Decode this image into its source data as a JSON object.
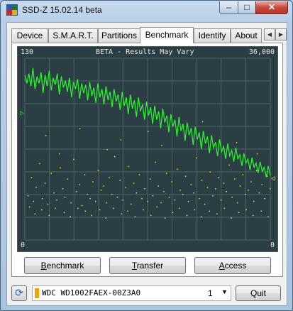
{
  "window": {
    "title": "SSD-Z 15.02.14 beta",
    "caption": {
      "minimize": "–",
      "maximize": "□",
      "close": "✕"
    }
  },
  "tabs": [
    {
      "label": "Device",
      "active": false
    },
    {
      "label": "S.M.A.R.T.",
      "active": false
    },
    {
      "label": "Partitions",
      "active": false
    },
    {
      "label": "Benchmark",
      "active": true
    },
    {
      "label": "Identify",
      "active": false
    },
    {
      "label": "About",
      "active": false
    }
  ],
  "tab_scroll": {
    "left": "◀",
    "right": "▶"
  },
  "graph": {
    "title": "BETA - Results May Vary",
    "left_max": "130",
    "right_max": "36,000",
    "left_min": "0",
    "right_min": "0",
    "left_marker": "▷",
    "right_marker": "◁",
    "colors": {
      "background": "#2b3e44",
      "grid": "#4f6167",
      "line": "#22ff22",
      "dots": "#e6e600"
    }
  },
  "buttons": {
    "benchmark": {
      "underline": "B",
      "rest": "enchmark"
    },
    "transfer": {
      "underline": "T",
      "rest": "ransfer"
    },
    "access": {
      "underline": "A",
      "rest": "ccess"
    }
  },
  "bottom": {
    "refresh_icon": "refresh-icon",
    "drive_name": "WDC WD1002FAEX-00Z3A0",
    "drive_index": "1",
    "drive_color": "#f6a000",
    "dropdown_icon": "▼",
    "quit_label": "Quit"
  },
  "chart_data": {
    "type": "line",
    "title": "BETA - Results May Vary",
    "ylim_left": [
      0,
      130
    ],
    "ylim_right": [
      0,
      36000
    ],
    "series": [
      {
        "values": [
          118,
          112,
          119,
          110,
          123,
          108,
          117,
          112,
          120,
          105,
          118,
          110,
          121,
          107,
          116,
          111,
          119,
          104,
          117,
          109,
          114,
          106,
          116,
          102,
          113,
          108,
          115,
          101,
          112,
          105,
          111,
          100,
          113,
          103,
          109,
          98,
          112,
          102,
          108,
          97,
          110,
          100,
          106,
          95,
          108,
          99,
          104,
          93,
          106,
          96,
          102,
          90,
          104,
          94,
          100,
          88,
          102,
          92,
          97,
          86,
          99,
          89,
          95,
          83,
          96,
          86,
          92,
          80,
          94,
          84,
          89,
          77,
          90,
          81,
          86,
          74,
          88,
          78,
          83,
          71,
          84,
          75,
          80,
          68,
          81,
          72,
          77,
          65,
          78,
          69,
          74,
          62,
          75,
          66,
          70,
          60,
          72,
          63,
          67,
          58,
          69,
          60,
          64,
          56,
          66,
          58,
          61,
          53,
          62,
          55,
          58,
          50,
          59,
          52,
          55,
          48,
          56,
          49,
          52,
          45,
          53,
          46
        ]
      }
    ],
    "scatter": {
      "points": [
        [
          4,
          32
        ],
        [
          9,
          45
        ],
        [
          12,
          28
        ],
        [
          16,
          38
        ],
        [
          21,
          55
        ],
        [
          25,
          30
        ],
        [
          29,
          41
        ],
        [
          33,
          26
        ],
        [
          38,
          48
        ],
        [
          42,
          34
        ],
        [
          46,
          29
        ],
        [
          51,
          52
        ],
        [
          55,
          37
        ],
        [
          58,
          31
        ],
        [
          62,
          44
        ],
        [
          67,
          27
        ],
        [
          71,
          58
        ],
        [
          75,
          35
        ],
        [
          79,
          40
        ],
        [
          83,
          25
        ],
        [
          87,
          47
        ],
        [
          91,
          33
        ],
        [
          95,
          30
        ],
        [
          99,
          42
        ],
        [
          103,
          28
        ],
        [
          107,
          50
        ],
        [
          111,
          36
        ],
        [
          115,
          39
        ],
        [
          119,
          27
        ],
        [
          123,
          45
        ],
        [
          127,
          33
        ],
        [
          131,
          60
        ],
        [
          135,
          31
        ],
        [
          139,
          43
        ],
        [
          143,
          29
        ],
        [
          147,
          38
        ],
        [
          151,
          53
        ],
        [
          155,
          26
        ],
        [
          159,
          41
        ],
        [
          163,
          34
        ],
        [
          167,
          47
        ],
        [
          171,
          30
        ],
        [
          175,
          37
        ],
        [
          179,
          28
        ],
        [
          183,
          44
        ],
        [
          187,
          32
        ],
        [
          191,
          56
        ],
        [
          195,
          39
        ],
        [
          199,
          27
        ],
        [
          203,
          35
        ],
        [
          207,
          48
        ],
        [
          211,
          31
        ],
        [
          215,
          42
        ],
        [
          219,
          29
        ],
        [
          223,
          51
        ],
        [
          227,
          36
        ],
        [
          231,
          33
        ],
        [
          235,
          46
        ],
        [
          239,
          28
        ],
        [
          243,
          40
        ],
        [
          247,
          34
        ],
        [
          251,
          59
        ],
        [
          255,
          30
        ],
        [
          259,
          43
        ],
        [
          263,
          26
        ],
        [
          267,
          38
        ],
        [
          271,
          49
        ],
        [
          275,
          32
        ],
        [
          279,
          37
        ],
        [
          283,
          45
        ],
        [
          287,
          29
        ],
        [
          291,
          41
        ],
        [
          295,
          35
        ],
        [
          299,
          54
        ],
        [
          303,
          31
        ],
        [
          307,
          44
        ],
        [
          311,
          27
        ],
        [
          315,
          39
        ],
        [
          319,
          47
        ],
        [
          323,
          33
        ],
        [
          327,
          36
        ],
        [
          331,
          42
        ],
        [
          335,
          28
        ],
        [
          339,
          50
        ],
        [
          343,
          34
        ],
        [
          347,
          40
        ],
        [
          351,
          30
        ],
        [
          355,
          46
        ],
        [
          359,
          37
        ],
        [
          6,
          24
        ],
        [
          14,
          19
        ],
        [
          24,
          22
        ],
        [
          35,
          18
        ],
        [
          44,
          23
        ],
        [
          57,
          20
        ],
        [
          66,
          17
        ],
        [
          77,
          23
        ],
        [
          88,
          21
        ],
        [
          97,
          18
        ],
        [
          109,
          22
        ],
        [
          118,
          16
        ],
        [
          129,
          23
        ],
        [
          141,
          19
        ],
        [
          150,
          21
        ],
        [
          161,
          17
        ],
        [
          173,
          22
        ],
        [
          184,
          18
        ],
        [
          193,
          24
        ],
        [
          205,
          16
        ],
        [
          216,
          20
        ],
        [
          226,
          23
        ],
        [
          237,
          18
        ],
        [
          248,
          22
        ],
        [
          258,
          17
        ],
        [
          270,
          21
        ],
        [
          281,
          19
        ],
        [
          292,
          23
        ],
        [
          302,
          16
        ],
        [
          313,
          20
        ],
        [
          324,
          22
        ],
        [
          334,
          18
        ],
        [
          346,
          21
        ],
        [
          356,
          17
        ],
        [
          30,
          75
        ],
        [
          80,
          80
        ],
        [
          140,
          72
        ],
        [
          200,
          68
        ],
        [
          260,
          85
        ],
        [
          310,
          70
        ],
        [
          340,
          62
        ],
        [
          120,
          65
        ],
        [
          180,
          78
        ],
        [
          50,
          62
        ]
      ]
    }
  }
}
